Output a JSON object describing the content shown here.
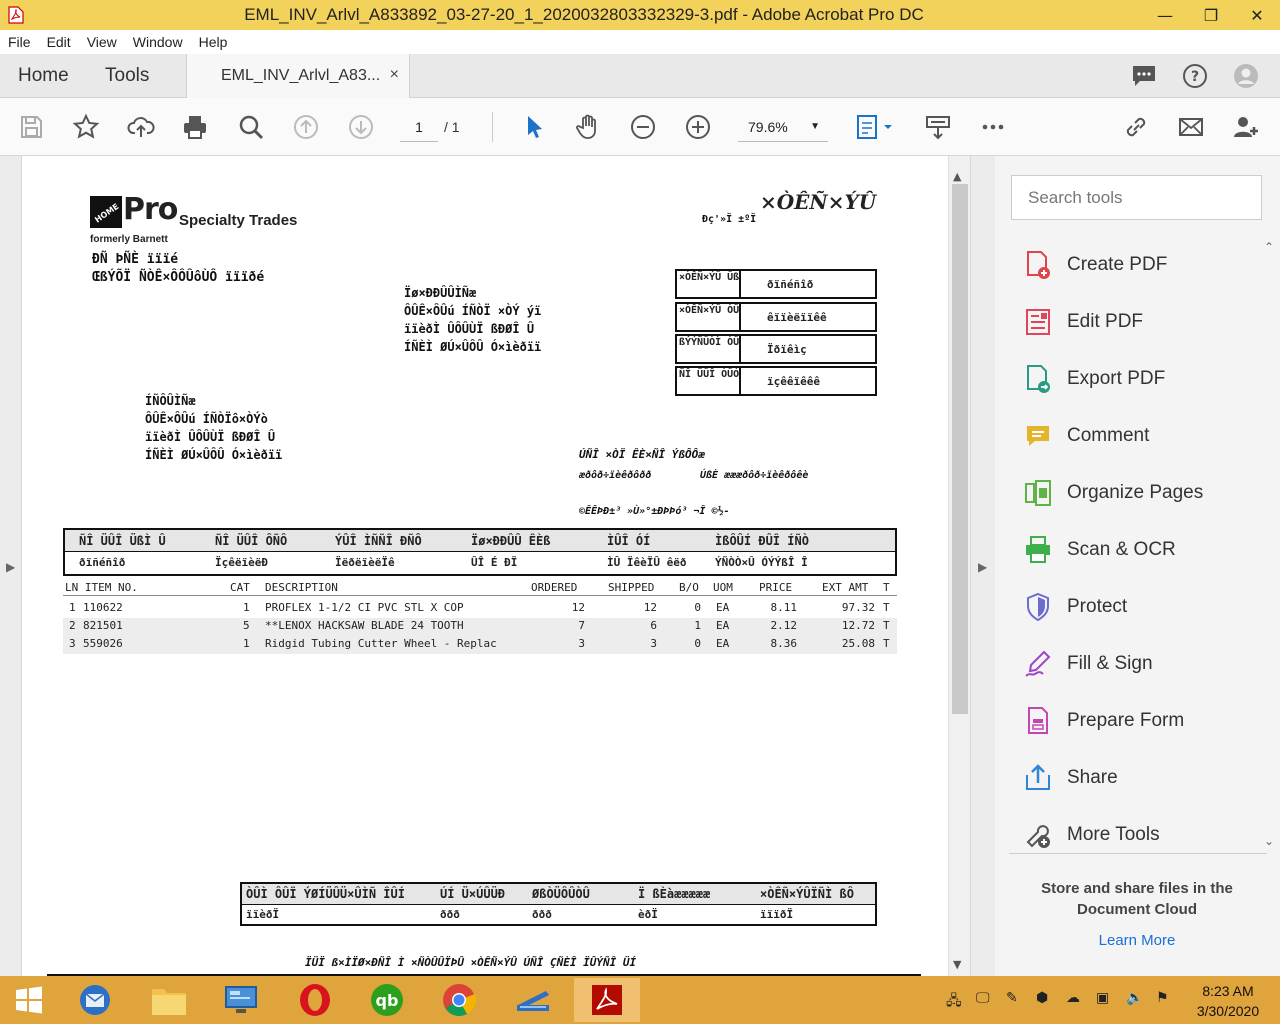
{
  "window": {
    "title": "EML_INV_Arlvl_A833892_03-27-20_1_2020032803332329-3.pdf - Adobe Acrobat Pro DC"
  },
  "menu": [
    "File",
    "Edit",
    "View",
    "Window",
    "Help"
  ],
  "tabs": {
    "home": "Home",
    "tools": "Tools",
    "document": "EML_INV_Arlvl_A83...",
    "close": "×"
  },
  "toolbar": {
    "page_current": "1",
    "page_total": "/ 1",
    "zoom": "79.6%"
  },
  "pdf": {
    "brand_pro": "Pro",
    "brand_specialty": "Specialty Trades",
    "brand_formerly": "formerly Barnett",
    "addr_line1": "ÐÑ ÞÑÈ ïïïé",
    "addr_line2": "ŒßÝÕÏ ÑÒÊ×ÔÔÛôÙÔ ïïïðé",
    "invoice_title": "×ÒÊÑ×ÝÛ",
    "invoice_sub": "Ðç'»Ï ±ºÏ",
    "billto": [
      "Ïø×ÐÐÛÛÌÑæ",
      "ÔÛÊ×ÔÛú ÍÑÒÏ ×ÒÝ ýï",
      "ïïèðÌ ÛÔÛÙÏ ßÐØÎ Û",
      "ÍÑÈÌ ØÚ×ÛÔÛ Ó×ìèðïï"
    ],
    "shipto": [
      "ÍÑÔÛÌÑæ",
      "ÔÛÊ×ÔÛú ÍÑÒÏô×ÒÝò",
      "ïïèðÌ ÛÔÛÙÏ ßÐØÎ Û",
      "ÍÑÈÌ ØÚ×ÛÔÛ Ó×ìèðïï"
    ],
    "infoboxes": [
      {
        "label": "×ÒÊÑ×ÝÛ ÛßÌ Û",
        "value": "ðïñéñîð"
      },
      {
        "label": "×ÒÊÑ×ÝÛ ÒÛÓ ÞÛÎ",
        "value": "êïïèëïïêê"
      },
      {
        "label": "ßÝÝÑÛÒÌ ÒÛÓ ÞÛÎ",
        "value": "Ïðïêìç"
      },
      {
        "label": "ÑÎ ÜÛÎ ÒÛÓ ÞÛÎ",
        "value": "ïçêêïêêê"
      }
    ],
    "remit": [
      "ÚÑÎ ×ÒÏ ÊÈ×ÑÎ ÝßÔÔæ",
      "æðôð÷ïèêðôðð",
      "ÚßÈ æææðôð÷ïèêðôêè",
      "©ÊÊÞÐ±³ »Ù»°±ÐÞÞó³ ¬Î ©½-"
    ],
    "header_labels": [
      "ÑÎ ÜÛÎ ÜßÌ Û",
      "ÑÎ ÜÛÎ ÔÑÔ",
      "ÝÛÎ ÌÑÑÎ ÐÑÔ",
      "Ïø×ÐÐÛÛ ÊÈß",
      "ÌÛÎ ÓÍ",
      "ÌßÔÛÍ ÐÛÎ ÍÑÒ"
    ],
    "header_values": [
      "ðïñéñîð",
      "ÏçêëïèëÐ",
      "ÏëðëïèëÏê",
      "ÛÎ É ÐÏ",
      "ÌÛ ÏêèÏÛ êëð",
      "ÝÑÒÒ×Û ÓÝÝßÎ Î"
    ],
    "columns": [
      "LN ITEM NO.",
      "CAT",
      "DESCRIPTION",
      "ORDERED",
      "SHIPPED",
      "B/O",
      "UOM",
      "PRICE",
      "EXT AMT",
      "T"
    ],
    "items": [
      {
        "ln": "1",
        "item": "110622",
        "cat": "1",
        "desc": "PROFLEX 1-1/2 CI PVC STL X COP",
        "ordered": "12",
        "shipped": "12",
        "bo": "0",
        "uom": "EA",
        "price": "8.11",
        "ext": "97.32",
        "t": "T"
      },
      {
        "ln": "2",
        "item": "821501",
        "cat": "5",
        "desc": "**LENOX HACKSAW BLADE 24 TOOTH",
        "ordered": "7",
        "shipped": "6",
        "bo": "1",
        "uom": "EA",
        "price": "2.12",
        "ext": "12.72",
        "t": "T"
      },
      {
        "ln": "3",
        "item": "559026",
        "cat": "1",
        "desc": "Ridgid Tubing Cutter Wheel - Replac",
        "ordered": "3",
        "shipped": "3",
        "bo": "0",
        "uom": "EA",
        "price": "8.36",
        "ext": "25.08",
        "t": "T"
      }
    ],
    "totals_labels": [
      "ÒÛÌ ÔÛÏ ÝØÍÜÛÜ×ÛÌÑ ÎÛÍ",
      "ÚÍ Ü×ÚÛÜÐ",
      "ØßÒÜÔÛÒÛ",
      "Ï ßÈàæææææ",
      "×ÒÊÑ×ÝÛÏÑÌ ßÔ"
    ],
    "totals_values": [
      "ïïèðÏ",
      "ððð",
      "ððð",
      "èðÏ",
      "ïïïðÏ"
    ],
    "footer_text": "ÏÜÏ ß×ÌÏØ×ÐÑÎ Ì ×ÑÒÛÛÏÞÛ ×ÒÊÑ×ÝÛ ÚÑÎ ÇÑÈÎ ÏÛÝÑÎ ÜÍ"
  },
  "tools_pane": {
    "search_placeholder": "Search tools",
    "tools": [
      {
        "label": "Create PDF",
        "icon": "create-pdf-icon",
        "color": "#e0454c"
      },
      {
        "label": "Edit PDF",
        "icon": "edit-pdf-icon",
        "color": "#e0455c"
      },
      {
        "label": "Export PDF",
        "icon": "export-pdf-icon",
        "color": "#2b9a84"
      },
      {
        "label": "Comment",
        "icon": "comment-icon",
        "color": "#e4b52a"
      },
      {
        "label": "Organize Pages",
        "icon": "organize-pages-icon",
        "color": "#5fb347"
      },
      {
        "label": "Scan & OCR",
        "icon": "scan-ocr-icon",
        "color": "#3fae4c"
      },
      {
        "label": "Protect",
        "icon": "protect-icon",
        "color": "#6b6bd0"
      },
      {
        "label": "Fill & Sign",
        "icon": "fill-sign-icon",
        "color": "#9b45c9"
      },
      {
        "label": "Prepare Form",
        "icon": "prepare-form-icon",
        "color": "#c546b0"
      },
      {
        "label": "Share",
        "icon": "share-icon",
        "color": "#2f86d6"
      },
      {
        "label": "More Tools",
        "icon": "more-tools-icon",
        "color": "#555555"
      }
    ],
    "promo_text": "Store and share files in the Document Cloud",
    "learn_more": "Learn More"
  },
  "taskbar": {
    "time": "8:23 AM",
    "date": "3/30/2020"
  }
}
